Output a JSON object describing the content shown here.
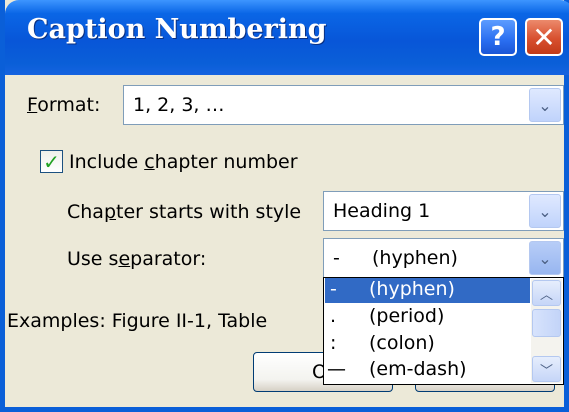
{
  "window": {
    "title": "Caption Numbering",
    "help_glyph": "?",
    "close_glyph": "✕"
  },
  "format": {
    "label_accel": "F",
    "label_rest": "ormat:",
    "value": "1, 2, 3, …",
    "arrow": "⌄"
  },
  "include_chapter": {
    "checked": true,
    "check_glyph": "✓",
    "label_pre": "Include ",
    "label_accel": "c",
    "label_post": "hapter number"
  },
  "chapter_style": {
    "label_pre": "Cha",
    "label_accel": "p",
    "label_post": "ter starts with style",
    "value": "Heading 1",
    "arrow": "⌄"
  },
  "separator": {
    "label_pre": "Use s",
    "label_accel": "e",
    "label_post": "parator:",
    "value_symbol": "-",
    "value_text": "(hyphen)",
    "arrow": "⌄",
    "options": [
      {
        "symbol": "-",
        "text": "(hyphen)",
        "selected": true
      },
      {
        "symbol": ".",
        "text": "(period)",
        "selected": false
      },
      {
        "symbol": ":",
        "text": "(colon)",
        "selected": false
      },
      {
        "symbol": "—",
        "text": "(em-dash)",
        "selected": false
      }
    ],
    "scroll_up": "︿",
    "scroll_down": "﹀"
  },
  "examples": {
    "label": "Examples:",
    "text": "Figure II-1, Table"
  },
  "ok_button": {
    "label": "O"
  }
}
